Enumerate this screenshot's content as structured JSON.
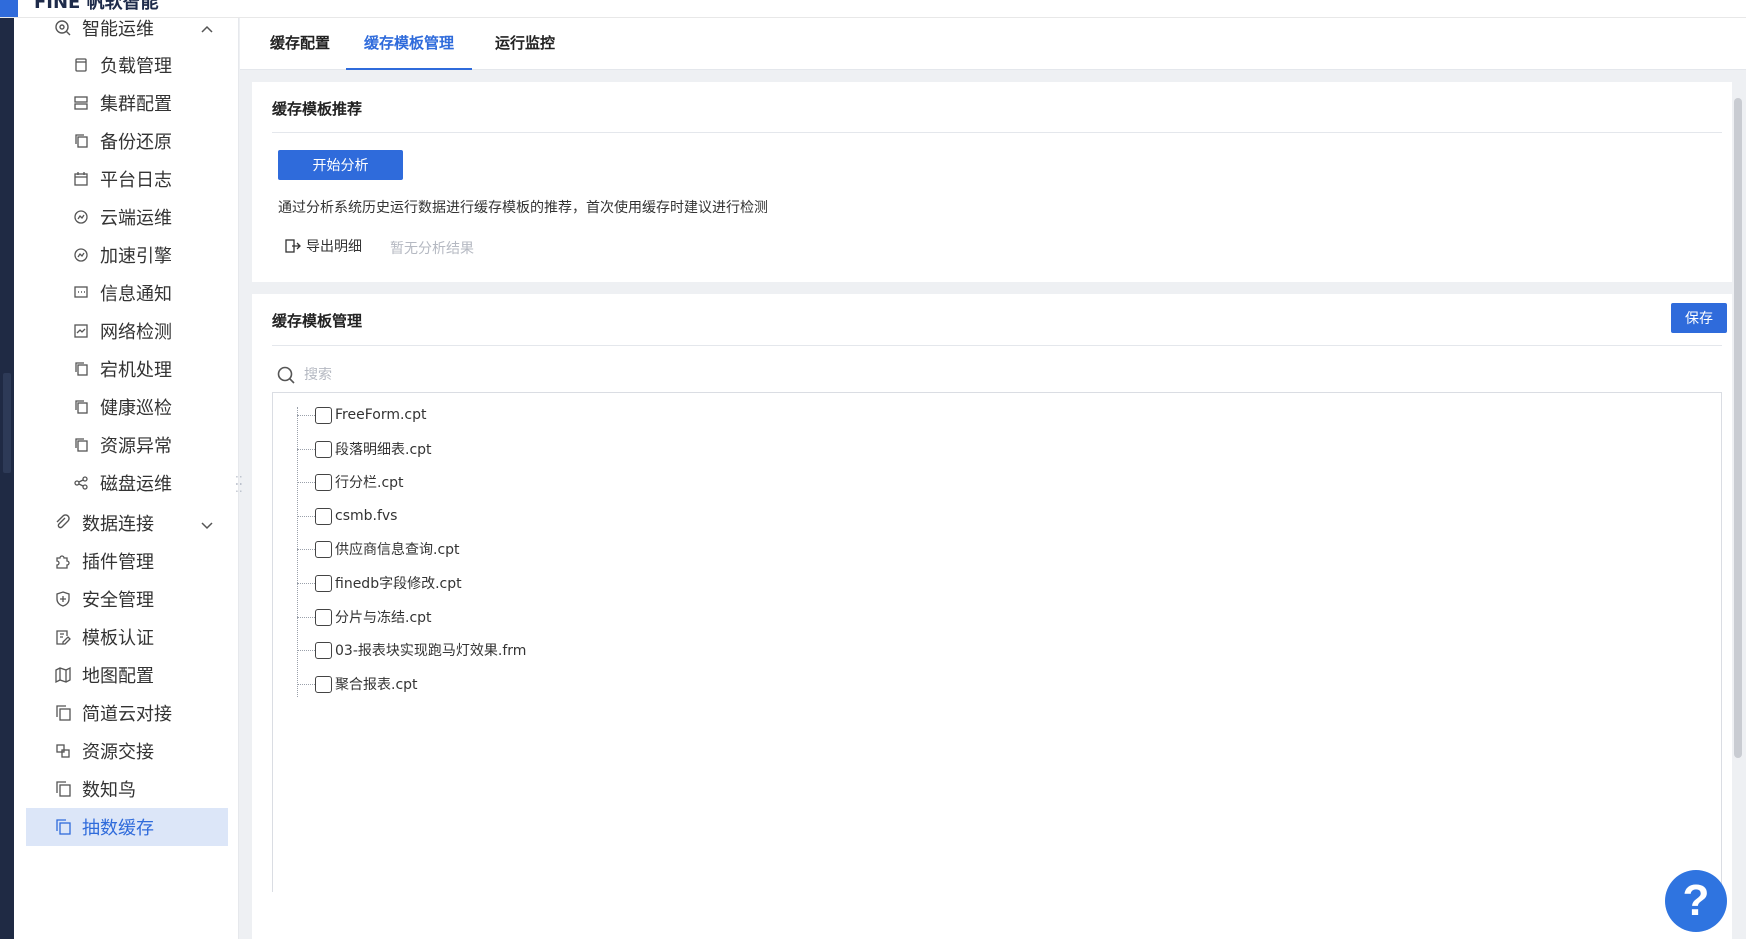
{
  "header": {
    "title_cut": "FINE 帆软智能"
  },
  "sidebar": {
    "items": [
      {
        "label": "智能运维",
        "icon": "ops-icon",
        "level": 1,
        "expanded": true
      },
      {
        "label": "负载管理",
        "icon": "doc-icon",
        "level": 2
      },
      {
        "label": "集群配置",
        "icon": "server-icon",
        "level": 2
      },
      {
        "label": "备份还原",
        "icon": "copy-icon",
        "level": 2
      },
      {
        "label": "平台日志",
        "icon": "calendar-icon",
        "level": 2
      },
      {
        "label": "云端运维",
        "icon": "cloud-icon",
        "level": 2
      },
      {
        "label": "加速引擎",
        "icon": "cloud-icon",
        "level": 2
      },
      {
        "label": "信息通知",
        "icon": "message-icon",
        "level": 2
      },
      {
        "label": "网络检测",
        "icon": "chart-icon",
        "level": 2
      },
      {
        "label": "宕机处理",
        "icon": "copy-icon",
        "level": 2
      },
      {
        "label": "健康巡检",
        "icon": "copy-icon",
        "level": 2
      },
      {
        "label": "资源异常",
        "icon": "copy-icon",
        "level": 2
      },
      {
        "label": "磁盘运维",
        "icon": "share-icon",
        "level": 2
      },
      {
        "label": "数据连接",
        "icon": "link-icon",
        "level": 1,
        "expanded": false
      },
      {
        "label": "插件管理",
        "icon": "puzzle-icon",
        "level": 1
      },
      {
        "label": "安全管理",
        "icon": "shield-icon",
        "level": 1
      },
      {
        "label": "模板认证",
        "icon": "edit-doc-icon",
        "level": 1
      },
      {
        "label": "地图配置",
        "icon": "map-icon",
        "level": 1
      },
      {
        "label": "简道云对接",
        "icon": "copy-icon",
        "level": 1
      },
      {
        "label": "资源交接",
        "icon": "exchange-icon",
        "level": 1
      },
      {
        "label": "数知鸟",
        "icon": "copy-icon",
        "level": 1
      },
      {
        "label": "抽数缓存",
        "icon": "copy-icon",
        "level": 1,
        "active": true
      }
    ]
  },
  "tabs": [
    {
      "label": "缓存配置"
    },
    {
      "label": "缓存模板管理",
      "active": true
    },
    {
      "label": "运行监控"
    }
  ],
  "recommend": {
    "title": "缓存模板推荐",
    "start_button": "开始分析",
    "description": "通过分析系统历史运行数据进行缓存模板的推荐，首次使用缓存时建议进行检测",
    "export_label": "导出明细",
    "no_result": "暂无分析结果"
  },
  "manage": {
    "title": "缓存模板管理",
    "save_button": "保存",
    "search_placeholder": "搜索",
    "templates": [
      {
        "name": "FreeForm.cpt",
        "checked": false
      },
      {
        "name": "段落明细表.cpt",
        "checked": false
      },
      {
        "name": "行分栏.cpt",
        "checked": false
      },
      {
        "name": "csmb.fvs",
        "checked": false
      },
      {
        "name": "供应商信息查询.cpt",
        "checked": false
      },
      {
        "name": "finedb字段修改.cpt",
        "checked": false
      },
      {
        "name": "分片与冻结.cpt",
        "checked": false
      },
      {
        "name": "03-报表块实现跑马灯效果.frm",
        "checked": false
      },
      {
        "name": "聚合报表.cpt",
        "checked": false
      }
    ]
  },
  "help": {
    "label": "?"
  },
  "colors": {
    "accent": "#2f6bdb",
    "active_bg": "#dce6f8",
    "rail": "#1f2a44"
  }
}
